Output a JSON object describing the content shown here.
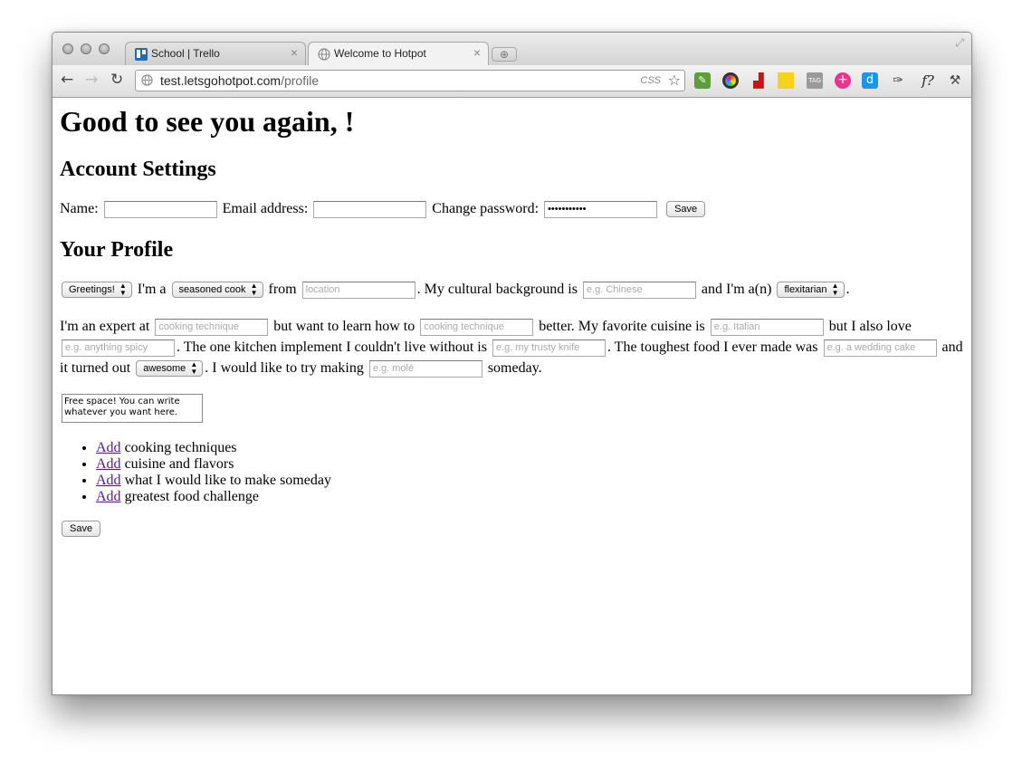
{
  "browser": {
    "tabs": [
      {
        "title": "School | Trello",
        "icon": "trello-icon",
        "active": false
      },
      {
        "title": "Welcome to Hotpot",
        "icon": "globe-icon",
        "active": true
      }
    ],
    "url_host": "test.letsgohotpot.com",
    "url_path": "/profile",
    "omnibox_badge": "CSS",
    "extensions": [
      {
        "name": "evernote-icon",
        "color": "#5c9e3a"
      },
      {
        "name": "color-wheel-icon",
        "color": "#333333"
      },
      {
        "name": "sofa-icon",
        "color": "#c01818"
      },
      {
        "name": "sticky-note-icon",
        "color": "#f6d21c"
      },
      {
        "name": "tag-icon",
        "color": "#9a9a9a"
      },
      {
        "name": "plus-circle-icon",
        "color": "#e8348c"
      },
      {
        "name": "d-icon",
        "color": "#1e96e6"
      },
      {
        "name": "pin-icon",
        "color": "#444444"
      },
      {
        "name": "f-help-icon",
        "color": "#222222"
      },
      {
        "name": "tools-icon",
        "color": "#c02020"
      }
    ]
  },
  "page": {
    "greeting": "Good to see you again, !",
    "account": {
      "heading": "Account Settings",
      "name_label": "Name:",
      "email_label": "Email address:",
      "password_label": "Change password:",
      "password_value": "•••••••••••",
      "save_label": "Save"
    },
    "profile": {
      "heading": "Your Profile",
      "greeting_select": "Greetings!",
      "t_im_a": "I'm a",
      "cook_select": "seasoned cook",
      "t_from": "from",
      "location_ph": "location",
      "t_cultural": ". My cultural background is",
      "culture_ph": "e.g. Chinese",
      "t_and_im": "and I'm a(n)",
      "diet_select": "flexitarian",
      "t_period": ".",
      "t_expert": "I'm an expert at",
      "expert_ph": "cooking technique",
      "t_learn": "but want to learn how to",
      "learn_ph": "cooking technique",
      "t_fav": "better. My favorite cuisine is",
      "fav_ph": "e.g. Italian",
      "t_also": "but I also love",
      "love_ph": "e.g. anything spicy",
      "t_implement": ". The one kitchen implement I couldn't live without is",
      "implement_ph": "e.g. my trusty knife",
      "t_toughest": ". The toughest food I ever made was",
      "toughest_ph": "e.g. a wedding cake",
      "t_and": "and",
      "t_turned": "it turned out",
      "turned_select": "awesome",
      "t_try": ". I would like to try making",
      "try_ph": "e.g. molé",
      "t_someday": "someday.",
      "free_text": "Free space! You can write whatever you want here.",
      "add_items": [
        {
          "link": "Add",
          "text": "cooking techniques"
        },
        {
          "link": "Add",
          "text": "cuisine and flavors"
        },
        {
          "link": "Add",
          "text": "what I would like to make someday"
        },
        {
          "link": "Add",
          "text": "greatest food challenge"
        }
      ],
      "save_label": "Save"
    }
  }
}
